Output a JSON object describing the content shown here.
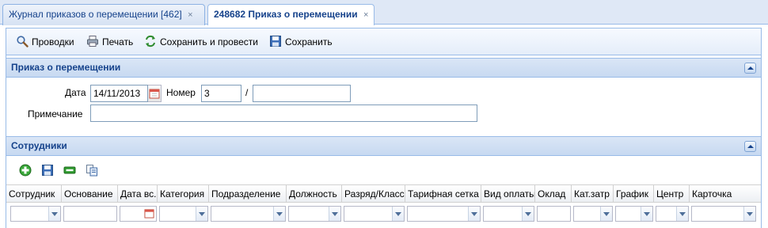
{
  "tabs": [
    {
      "label": "Журнал приказов о перемещении [462]",
      "close": "×"
    },
    {
      "label": "248682 Приказ о перемещении",
      "close": "×"
    }
  ],
  "toolbar": {
    "postings": "Проводки",
    "print": "Печать",
    "save_post": "Сохранить и провести",
    "save": "Сохранить"
  },
  "order_panel": {
    "title": "Приказ о перемещении",
    "date_label": "Дата",
    "date_value": "14/11/2013",
    "number_label": "Номер",
    "number_value": "3",
    "slash": "/",
    "number_suffix_value": "",
    "note_label": "Примечание",
    "note_value": ""
  },
  "employees_panel": {
    "title": "Сотрудники",
    "columns": [
      "Сотрудник",
      "Основание",
      "Дата вс.",
      "Категория",
      "Подразделение",
      "Должность",
      "Разряд/Класс",
      "Тарифная сетка",
      "Вид оплаты",
      "Оклад",
      "Кат.затр",
      "График",
      "Центр",
      "Карточка"
    ]
  },
  "icons": {
    "postings": "magnifier-icon",
    "print": "printer-icon",
    "save_post": "refresh-icon",
    "save": "floppy-disk-icon",
    "add": "plus-icon",
    "grid_save": "floppy-disk-icon",
    "remove": "minus-icon",
    "copy": "copy-icon"
  }
}
